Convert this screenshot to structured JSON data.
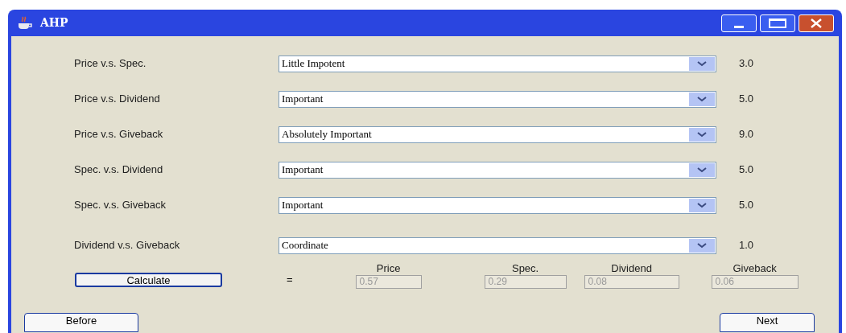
{
  "window": {
    "title": "AHP"
  },
  "comparisons": [
    {
      "label": "Price v.s. Spec.",
      "choice": "Little Impotent",
      "value": "3.0"
    },
    {
      "label": "Price v.s. Dividend",
      "choice": "Important",
      "value": "5.0"
    },
    {
      "label": "Price v.s. Giveback",
      "choice": "Absolutely Important",
      "value": "9.0"
    },
    {
      "label": "Spec. v.s. Dividend",
      "choice": "Important",
      "value": "5.0"
    },
    {
      "label": "Spec. v.s. Giveback",
      "choice": "Important",
      "value": "5.0"
    },
    {
      "label": "Dividend v.s. Giveback",
      "choice": "Coordinate",
      "value": "1.0"
    }
  ],
  "calculate_button": "Calculate",
  "equals": "=",
  "results": [
    {
      "label": "Price",
      "value": "0.57"
    },
    {
      "label": "Spec.",
      "value": "0.29"
    },
    {
      "label": "Dividend",
      "value": "0.08"
    },
    {
      "label": "Giveback",
      "value": "0.06"
    }
  ],
  "buttons": {
    "before": "Before",
    "next": "Next"
  }
}
